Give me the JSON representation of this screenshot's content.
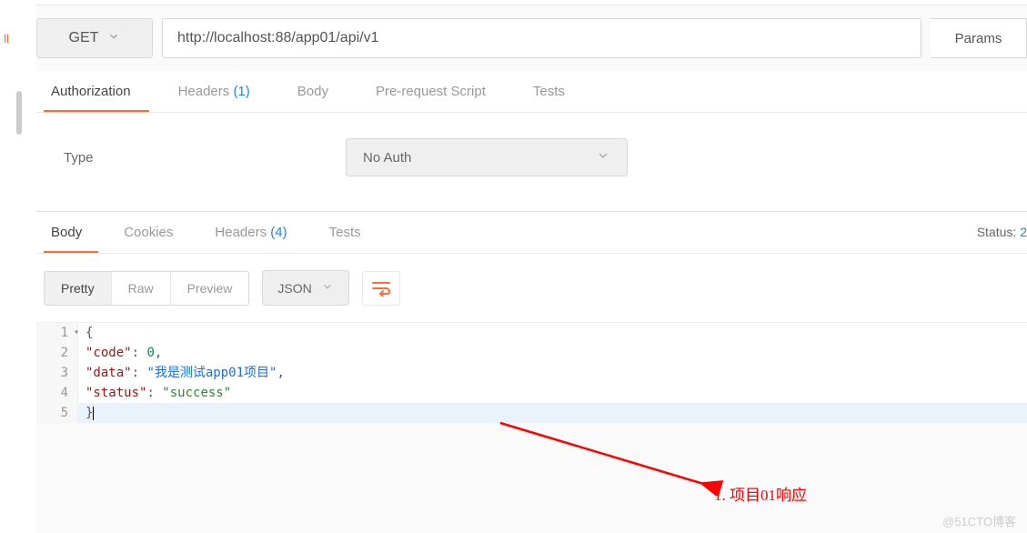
{
  "sidebar": {
    "truncated_label": "ll"
  },
  "request": {
    "method": "GET",
    "url": "http://localhost:88/app01/api/v1",
    "params_btn": "Params"
  },
  "req_tabs": {
    "authorization": "Authorization",
    "headers_label": "Headers",
    "headers_count": "(1)",
    "body": "Body",
    "prerequest": "Pre-request Script",
    "tests": "Tests"
  },
  "auth": {
    "type_label": "Type",
    "selected": "No Auth"
  },
  "resp_tabs": {
    "body": "Body",
    "cookies": "Cookies",
    "headers_label": "Headers",
    "headers_count": "(4)",
    "tests": "Tests"
  },
  "status": {
    "label": "Status:",
    "value": "2"
  },
  "body_toolbar": {
    "pretty": "Pretty",
    "raw": "Raw",
    "preview": "Preview",
    "format": "JSON"
  },
  "response_json": {
    "lines": [
      {
        "n": "1",
        "text_pre": "{",
        "has_fold": true
      },
      {
        "n": "2",
        "indent": "    ",
        "key": "\"code\"",
        "sep": ": ",
        "val_num": "0",
        "trail": ","
      },
      {
        "n": "3",
        "indent": "    ",
        "key": "\"data\"",
        "sep": ": ",
        "val_str": "\"我是测试app01项目\"",
        "trail": ","
      },
      {
        "n": "4",
        "indent": "    ",
        "key": "\"status\"",
        "sep": ": ",
        "val_str2": "\"success\""
      },
      {
        "n": "5",
        "text_pre": "}",
        "hl": true,
        "cursor": true
      }
    ]
  },
  "annotation": {
    "text": "1. 项目01响应"
  },
  "watermark": "@51CTO博客"
}
